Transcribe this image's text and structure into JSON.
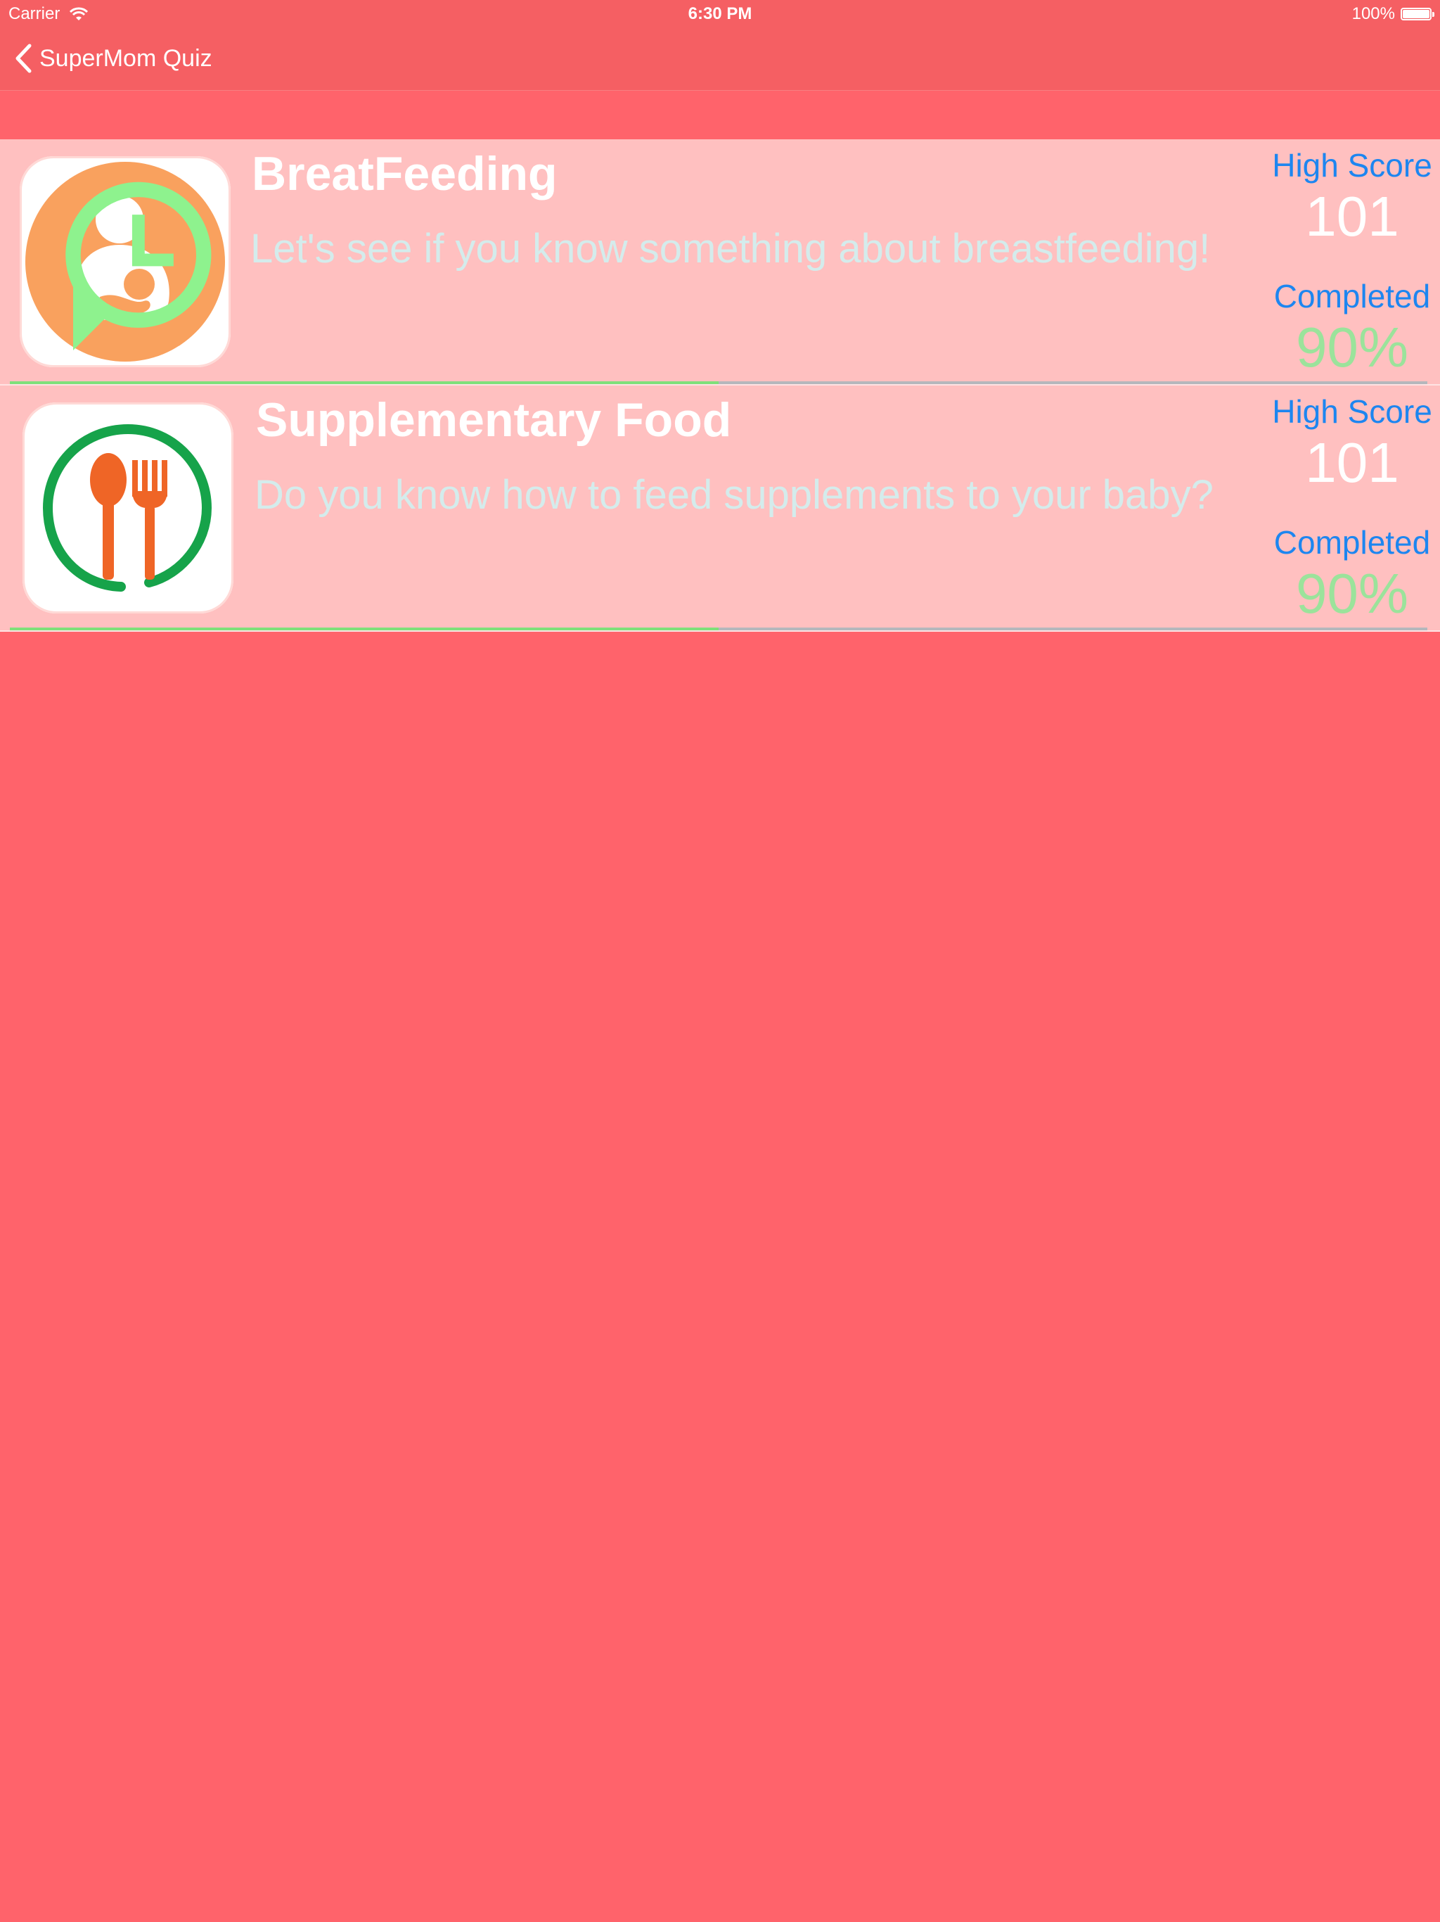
{
  "status_bar": {
    "carrier": "Carrier",
    "time": "6:30 PM",
    "battery": "100%",
    "battery_level": 1.0,
    "icons": [
      "wifi-icon",
      "battery-icon"
    ]
  },
  "nav": {
    "back_label": "SuperMom Quiz",
    "back_icon": "chevron-left-icon"
  },
  "colors": {
    "background": "#ff636b",
    "bar": "#f55f63",
    "row_background": "#ffc0c0",
    "title": "#ffffff",
    "description": "#d4ecec",
    "stat_label": "#1d86f0",
    "completed_value": "#9be39b",
    "progress_fill": "#7fe07a",
    "progress_track": "#b5b7bc"
  },
  "quizzes": [
    {
      "title": "BreatFeeding",
      "description": "Let's see if you know something about breastfeeding!",
      "high_score_label": "High Score",
      "high_score": "101",
      "completed_label": "Completed",
      "completed": "90%",
      "progress": 0.5,
      "icon": "breastfeeding-icon",
      "badge_icon": "history-icon"
    },
    {
      "title": "Supplementary Food",
      "description": "Do you know how to feed supplements to your baby?",
      "high_score_label": "High Score",
      "high_score": "101",
      "completed_label": "Completed",
      "completed": "90%",
      "progress": 0.5,
      "icon": "spoon-fork-icon"
    }
  ]
}
